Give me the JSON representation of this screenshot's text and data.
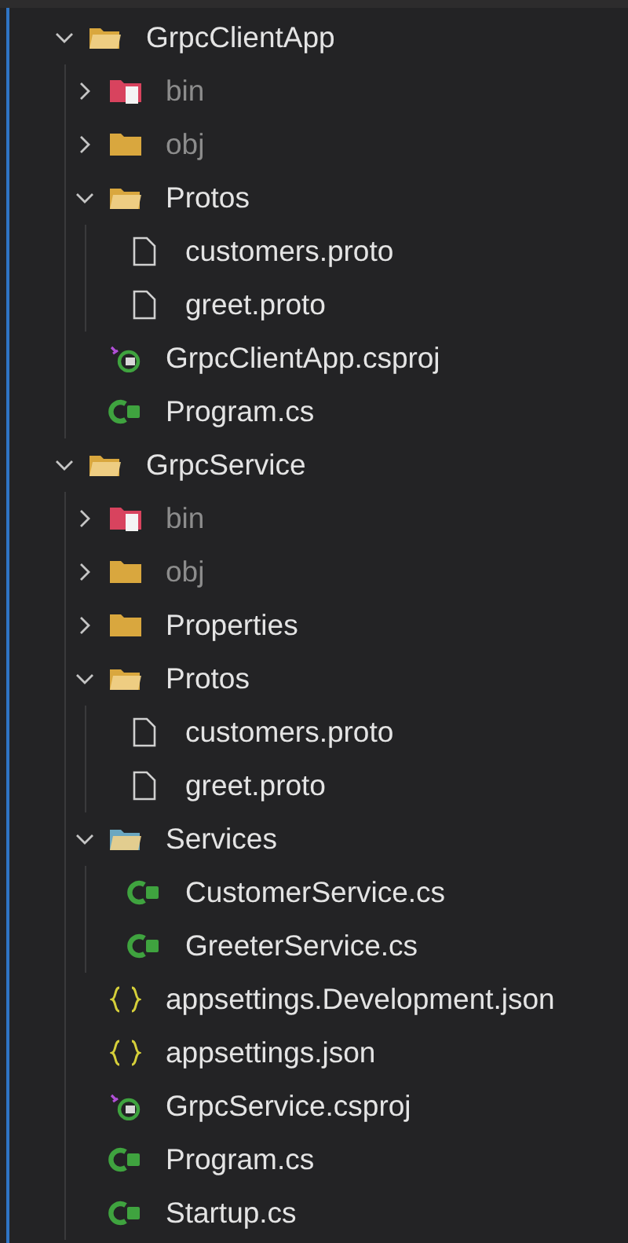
{
  "tree": [
    {
      "label": "GrpcClientApp",
      "kind": "folder",
      "expanded": true,
      "dimmed": false,
      "children": [
        {
          "label": "bin",
          "kind": "bin-folder",
          "expanded": false,
          "dimmed": true
        },
        {
          "label": "obj",
          "kind": "folder",
          "expanded": false,
          "dimmed": true
        },
        {
          "label": "Protos",
          "kind": "folder",
          "expanded": true,
          "dimmed": false,
          "children": [
            {
              "label": "customers.proto",
              "kind": "file",
              "dimmed": false
            },
            {
              "label": "greet.proto",
              "kind": "file",
              "dimmed": false
            }
          ]
        },
        {
          "label": "GrpcClientApp.csproj",
          "kind": "csproj",
          "dimmed": false
        },
        {
          "label": "Program.cs",
          "kind": "csharp",
          "dimmed": false
        }
      ]
    },
    {
      "label": "GrpcService",
      "kind": "folder",
      "expanded": true,
      "dimmed": false,
      "children": [
        {
          "label": "bin",
          "kind": "bin-folder",
          "expanded": false,
          "dimmed": true
        },
        {
          "label": "obj",
          "kind": "folder",
          "expanded": false,
          "dimmed": true
        },
        {
          "label": "Properties",
          "kind": "folder",
          "expanded": false,
          "dimmed": false
        },
        {
          "label": "Protos",
          "kind": "folder",
          "expanded": true,
          "dimmed": false,
          "children": [
            {
              "label": "customers.proto",
              "kind": "file",
              "dimmed": false
            },
            {
              "label": "greet.proto",
              "kind": "file",
              "dimmed": false
            }
          ]
        },
        {
          "label": "Services",
          "kind": "services-folder",
          "expanded": true,
          "dimmed": false,
          "children": [
            {
              "label": "CustomerService.cs",
              "kind": "csharp",
              "dimmed": false
            },
            {
              "label": "GreeterService.cs",
              "kind": "csharp",
              "dimmed": false
            }
          ]
        },
        {
          "label": "appsettings.Development.json",
          "kind": "json",
          "dimmed": false
        },
        {
          "label": "appsettings.json",
          "kind": "json",
          "dimmed": false
        },
        {
          "label": "GrpcService.csproj",
          "kind": "csproj",
          "dimmed": false
        },
        {
          "label": "Program.cs",
          "kind": "csharp",
          "dimmed": false
        },
        {
          "label": "Startup.cs",
          "kind": "csharp",
          "dimmed": false
        }
      ]
    }
  ]
}
